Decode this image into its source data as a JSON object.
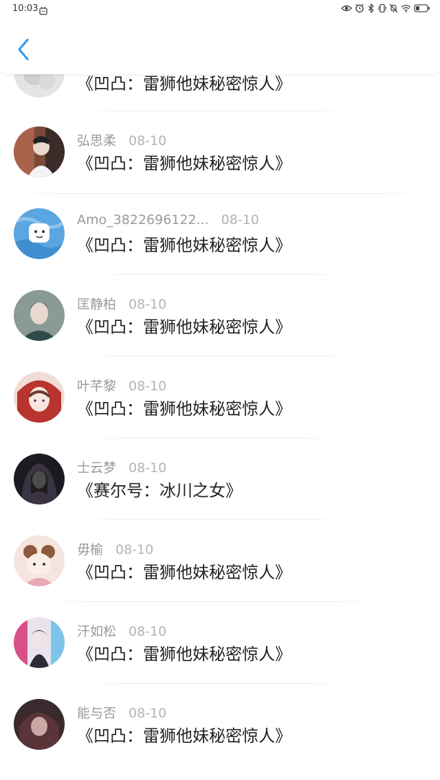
{
  "status_bar": {
    "time": "10:03"
  },
  "header": {
    "back_icon": "chevron-left-icon",
    "accent_color": "#2f9bf0"
  },
  "comments": [
    {
      "name": "",
      "date": "",
      "text": "《凹凸：雷狮他妹秘密惊人》"
    },
    {
      "name": "弘思柔",
      "date": "08-10",
      "text": "《凹凸：雷狮他妹秘密惊人》"
    },
    {
      "name": "Amo_3822696122...",
      "date": "08-10",
      "text": "《凹凸：雷狮他妹秘密惊人》"
    },
    {
      "name": "匡静柏",
      "date": "08-10",
      "text": "《凹凸：雷狮他妹秘密惊人》"
    },
    {
      "name": "叶芊黎",
      "date": "08-10",
      "text": "《凹凸：雷狮他妹秘密惊人》"
    },
    {
      "name": "士云梦",
      "date": "08-10",
      "text": "《赛尔号：冰川之女》"
    },
    {
      "name": "毋榆",
      "date": "08-10",
      "text": "《凹凸：雷狮他妹秘密惊人》"
    },
    {
      "name": "汗如松",
      "date": "08-10",
      "text": "《凹凸：雷狮他妹秘密惊人》"
    },
    {
      "name": "能与否",
      "date": "08-10",
      "text": "《凹凸：雷狮他妹秘密惊人》"
    }
  ]
}
